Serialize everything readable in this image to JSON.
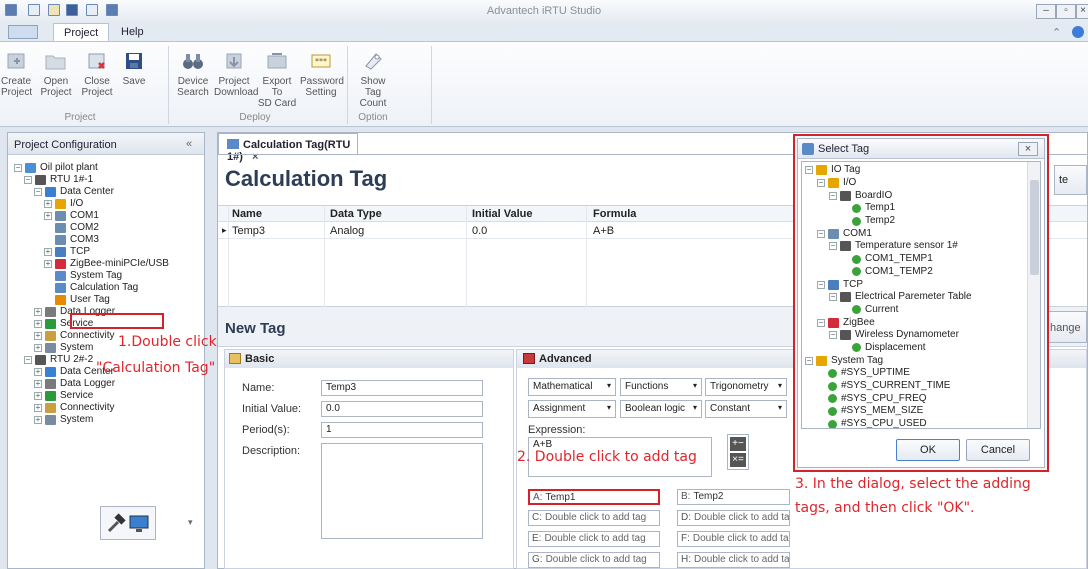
{
  "app": {
    "title": "Advantech iRTU Studio"
  },
  "ribbon": {
    "tabs": [
      "Project",
      "Help"
    ],
    "buttons": {
      "create_project": "Create\nProject",
      "open_project": "Open\nProject",
      "close_project": "Close\nProject",
      "save": "Save",
      "device_search": "Device\nSearch",
      "project_download": "Project\nDownload",
      "export_sd": "Export To\nSD Card",
      "password_setting": "Password\nSetting",
      "show_tag_count": "Show Tag\nCount"
    },
    "groups": [
      "Project",
      "Deploy",
      "Option"
    ]
  },
  "sidebar": {
    "title": "Project Configuration",
    "collapse_glyph": "«",
    "tree": [
      {
        "label": "Oil pilot plant",
        "indent": 0,
        "toggle": "−",
        "icon_color": "#4b8fd6"
      },
      {
        "label": "RTU 1#-1",
        "indent": 1,
        "toggle": "−",
        "icon_color": "#555"
      },
      {
        "label": "Data Center",
        "indent": 2,
        "toggle": "−",
        "icon_color": "#3a7fd0"
      },
      {
        "label": "I/O",
        "indent": 3,
        "toggle": "+",
        "icon_color": "#e6a500"
      },
      {
        "label": "COM1",
        "indent": 3,
        "toggle": "+",
        "icon_color": "#6c8cb0"
      },
      {
        "label": "COM2",
        "indent": 3,
        "toggle": "",
        "icon_color": "#6c8cb0"
      },
      {
        "label": "COM3",
        "indent": 3,
        "toggle": "",
        "icon_color": "#6c8cb0"
      },
      {
        "label": "TCP",
        "indent": 3,
        "toggle": "+",
        "icon_color": "#4a7fbf"
      },
      {
        "label": "ZigBee-miniPCIe/USB",
        "indent": 3,
        "toggle": "+",
        "icon_color": "#d22c3a"
      },
      {
        "label": "System Tag",
        "indent": 3,
        "toggle": "",
        "icon_color": "#5a8ac8"
      },
      {
        "label": "Calculation Tag",
        "indent": 3,
        "toggle": "",
        "icon_color": "#5a8ac8"
      },
      {
        "label": "User Tag",
        "indent": 3,
        "toggle": "",
        "icon_color": "#e68a00"
      },
      {
        "label": "Data Logger",
        "indent": 2,
        "toggle": "+",
        "icon_color": "#7a7a7a"
      },
      {
        "label": "Service",
        "indent": 2,
        "toggle": "+",
        "icon_color": "#2a9a3a"
      },
      {
        "label": "Connectivity",
        "indent": 2,
        "toggle": "+",
        "icon_color": "#c8a040"
      },
      {
        "label": "System",
        "indent": 2,
        "toggle": "+",
        "icon_color": "#7a8aa0"
      },
      {
        "label": "RTU 2#-2",
        "indent": 1,
        "toggle": "−",
        "icon_color": "#555"
      },
      {
        "label": "Data Center",
        "indent": 2,
        "toggle": "+",
        "icon_color": "#3a7fd0"
      },
      {
        "label": "Data Logger",
        "indent": 2,
        "toggle": "+",
        "icon_color": "#7a7a7a"
      },
      {
        "label": "Service",
        "indent": 2,
        "toggle": "+",
        "icon_color": "#2a9a3a"
      },
      {
        "label": "Connectivity",
        "indent": 2,
        "toggle": "+",
        "icon_color": "#c8a040"
      },
      {
        "label": "System",
        "indent": 2,
        "toggle": "+",
        "icon_color": "#7a8aa0"
      }
    ]
  },
  "main": {
    "doc_tab": "Calculation Tag(RTU 1#)",
    "doc_tab_close": "×",
    "heading": "Calculation Tag",
    "right_button_1": "te",
    "right_button_2": "hange",
    "table": {
      "columns": [
        "Name",
        "Data Type",
        "Initial Value",
        "Formula"
      ],
      "rows": [
        [
          "Temp3",
          "Analog",
          "0.0",
          "A+B"
        ]
      ],
      "row_marker": "▸"
    },
    "new_tag_heading": "New Tag",
    "basic": {
      "title": "Basic",
      "name_label": "Name:",
      "name_value": "Temp3",
      "initial_label": "Initial Value:",
      "initial_value": "0.0",
      "period_label": "Period(s):",
      "period_value": "1",
      "description_label": "Description:"
    },
    "advanced": {
      "title": "Advanced",
      "selects_row1": [
        "Mathematical",
        "Functions",
        "Trigonometry"
      ],
      "selects_row2": [
        "Assignment",
        "Boolean logic",
        "Constant"
      ],
      "expression_label": "Expression:",
      "expression_value": "A+B",
      "slots": [
        {
          "key": "A:",
          "value": "Temp1"
        },
        {
          "key": "B:",
          "value": "Temp2"
        },
        {
          "key": "C:",
          "value": "Double click to add tag"
        },
        {
          "key": "D:",
          "value": "Double click to add tag."
        },
        {
          "key": "E:",
          "value": "Double click to add tag"
        },
        {
          "key": "F:",
          "value": "Double click to add tag."
        },
        {
          "key": "G:",
          "value": "Double click to add tag"
        },
        {
          "key": "H:",
          "value": "Double click to add tag."
        }
      ]
    }
  },
  "annotations": {
    "step1_line1": "1.Double click",
    "step1_line2": "\"Calculation Tag\"",
    "step2": "2. Double click to add tag",
    "step3_line1": "3. In the dialog, select the adding",
    "step3_line2": "tags, and then click \"OK\"."
  },
  "dialog": {
    "title": "Select Tag",
    "close_glyph": "×",
    "tree": [
      {
        "label": "IO Tag",
        "indent": 0,
        "toggle": "−",
        "kind": "folder"
      },
      {
        "label": "I/O",
        "indent": 1,
        "toggle": "−",
        "kind": "io"
      },
      {
        "label": "BoardIO",
        "indent": 2,
        "toggle": "−",
        "kind": "device"
      },
      {
        "label": "Temp1",
        "indent": 3,
        "toggle": "",
        "kind": "tag"
      },
      {
        "label": "Temp2",
        "indent": 3,
        "toggle": "",
        "kind": "tag"
      },
      {
        "label": "COM1",
        "indent": 1,
        "toggle": "−",
        "kind": "com"
      },
      {
        "label": "Temperature sensor 1#",
        "indent": 2,
        "toggle": "−",
        "kind": "device"
      },
      {
        "label": "COM1_TEMP1",
        "indent": 3,
        "toggle": "",
        "kind": "tag"
      },
      {
        "label": "COM1_TEMP2",
        "indent": 3,
        "toggle": "",
        "kind": "tag"
      },
      {
        "label": "TCP",
        "indent": 1,
        "toggle": "−",
        "kind": "tcp"
      },
      {
        "label": "Electrical Paremeter Table",
        "indent": 2,
        "toggle": "−",
        "kind": "device"
      },
      {
        "label": "Current",
        "indent": 3,
        "toggle": "",
        "kind": "tag"
      },
      {
        "label": "ZigBee",
        "indent": 1,
        "toggle": "−",
        "kind": "zigbee"
      },
      {
        "label": "Wireless Dynamometer",
        "indent": 2,
        "toggle": "−",
        "kind": "device"
      },
      {
        "label": "Displacement",
        "indent": 3,
        "toggle": "",
        "kind": "tag"
      },
      {
        "label": "System Tag",
        "indent": 0,
        "toggle": "−",
        "kind": "folder"
      },
      {
        "label": "#SYS_UPTIME",
        "indent": 1,
        "toggle": "",
        "kind": "tag"
      },
      {
        "label": "#SYS_CURRENT_TIME",
        "indent": 1,
        "toggle": "",
        "kind": "tag"
      },
      {
        "label": "#SYS_CPU_FREQ",
        "indent": 1,
        "toggle": "",
        "kind": "tag"
      },
      {
        "label": "#SYS_MEM_SIZE",
        "indent": 1,
        "toggle": "",
        "kind": "tag"
      },
      {
        "label": "#SYS_CPU_USED",
        "indent": 1,
        "toggle": "",
        "kind": "tag"
      }
    ],
    "ok": "OK",
    "cancel": "Cancel"
  },
  "colors": {
    "accent": "#d2232a",
    "tag_green": "#3aa33a"
  }
}
